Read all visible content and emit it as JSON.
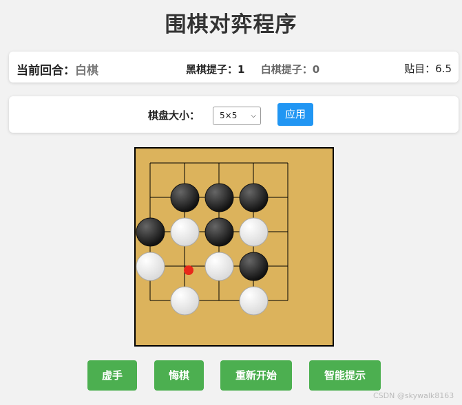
{
  "title": "围棋对弈程序",
  "status": {
    "turn_label": "当前回合：",
    "turn_value": "白棋",
    "black_captures_label": "黑棋提子：",
    "black_captures": "1",
    "white_captures_label": "白棋提子：",
    "white_captures": "0",
    "komi_label": "贴目：",
    "komi": "6.5"
  },
  "settings": {
    "size_label": "棋盘大小：",
    "size_selected": "5×5",
    "apply_label": "应用"
  },
  "board": {
    "size": 5,
    "last_move_marker": {
      "col": 1,
      "row": 3
    },
    "stones": [
      {
        "col": 1,
        "row": 1,
        "color": "black"
      },
      {
        "col": 2,
        "row": 1,
        "color": "black"
      },
      {
        "col": 3,
        "row": 1,
        "color": "black"
      },
      {
        "col": 0,
        "row": 2,
        "color": "black"
      },
      {
        "col": 1,
        "row": 2,
        "color": "white"
      },
      {
        "col": 2,
        "row": 2,
        "color": "black"
      },
      {
        "col": 3,
        "row": 2,
        "color": "white"
      },
      {
        "col": 0,
        "row": 3,
        "color": "white"
      },
      {
        "col": 2,
        "row": 3,
        "color": "white"
      },
      {
        "col": 3,
        "row": 3,
        "color": "black"
      },
      {
        "col": 1,
        "row": 4,
        "color": "white"
      },
      {
        "col": 3,
        "row": 4,
        "color": "white"
      }
    ]
  },
  "buttons": {
    "pass": "虚手",
    "undo": "悔棋",
    "restart": "重新开始",
    "hint": "智能提示"
  },
  "watermark": "CSDN @skywalk8163",
  "colors": {
    "board": "#dcb35c",
    "apply": "#2196f3",
    "action": "#4caf50",
    "marker": "#e8281a"
  }
}
